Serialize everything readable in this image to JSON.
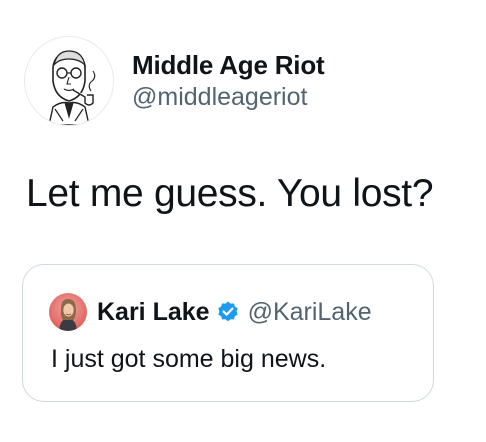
{
  "tweet": {
    "author": {
      "display_name": "Middle Age Riot",
      "handle": "@middleageriot",
      "avatar_icon": "vintage-man-with-pipe-illustration"
    },
    "text": "Let me guess. You lost?",
    "quoted_tweet": {
      "author": {
        "display_name": "Kari Lake",
        "handle": "@KariLake",
        "avatar_icon": "profile-photo",
        "verified": true,
        "verified_icon": "verified-badge-icon"
      },
      "text": "I just got some big news."
    }
  },
  "colors": {
    "text_primary": "#0f1419",
    "text_secondary": "#536471",
    "card_border": "#cfd9de",
    "verified_blue": "#1d9bf0",
    "background": "#ffffff"
  }
}
